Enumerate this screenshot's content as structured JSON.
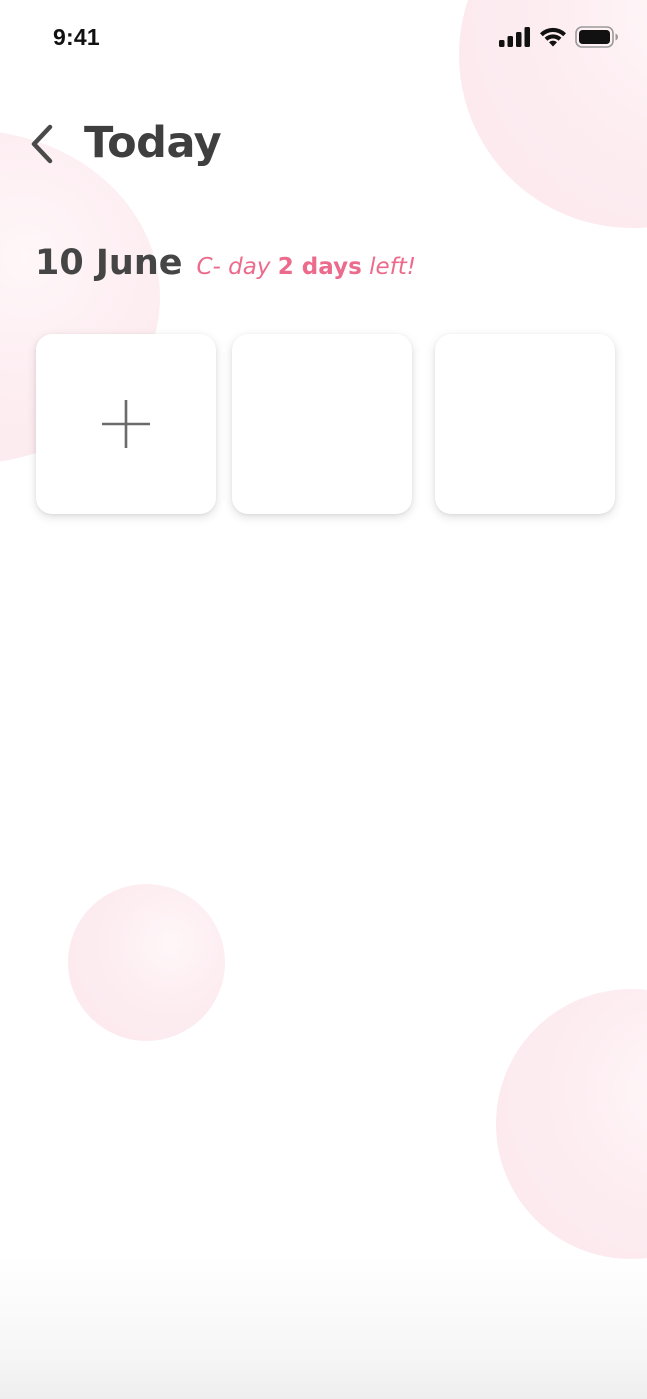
{
  "status_bar": {
    "time": "9:41",
    "icons": [
      "cellular-signal-icon",
      "wifi-icon",
      "battery-icon"
    ]
  },
  "header": {
    "back_icon": "chevron-left-icon",
    "title": "Today"
  },
  "date_row": {
    "date": "10 June",
    "countdown_prefix": "C- day",
    "countdown_value": "2 days",
    "countdown_suffix": "left!"
  },
  "photo_slots": [
    {
      "state": "add",
      "icon": "plus-icon"
    },
    {
      "state": "empty"
    },
    {
      "state": "empty"
    }
  ],
  "colors": {
    "accent": "#ec6b8c",
    "title_text": "#3f3f3f",
    "bubble": "#fbe7ec",
    "background": "#ffffff"
  }
}
